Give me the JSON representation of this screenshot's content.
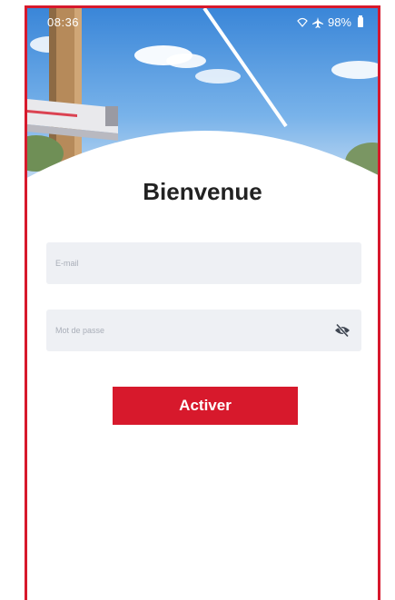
{
  "status_bar": {
    "time": "08:36",
    "battery": "98%",
    "icons": [
      "wifi-icon",
      "airplane-icon",
      "battery-icon"
    ]
  },
  "login": {
    "title": "Bienvenue",
    "email_placeholder": "E-mail",
    "email_value": "",
    "password_placeholder": "Mot de passe",
    "password_value": "",
    "password_toggle_icon": "eye-slash-icon",
    "submit_label": "Activer"
  },
  "colors": {
    "accent": "#d7192c",
    "field_bg": "#eef0f4",
    "title": "#222222"
  }
}
